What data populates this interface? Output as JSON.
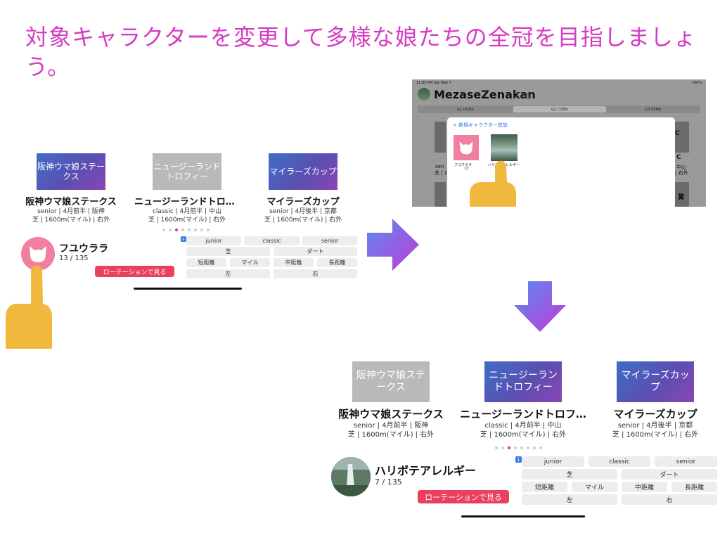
{
  "headline": "対象キャラクターを変更して多様な娘たちの全冠を目指しましょう。",
  "panel1": {
    "cards": [
      {
        "thumb": "阪神ウマ娘ステークス",
        "name": "阪神ウマ娘ステークス",
        "meta1": "senior | 4月前半 | 阪神",
        "meta2": "芝 | 1600m(マイル) | 右外"
      },
      {
        "thumb": "ニュージーランドトロフィー",
        "name": "ニュージーランドトロフ…",
        "meta1": "classic | 4月前半 | 中山",
        "meta2": "芝 | 1600m(マイル) | 右外"
      },
      {
        "thumb": "マイラーズカップ",
        "name": "マイラーズカップ",
        "meta1": "senior | 4月後半 | 京都",
        "meta2": "芝 | 1600m(マイル) | 右外"
      }
    ],
    "character": {
      "name": "フユウララ",
      "count": "13 / 135"
    },
    "rotation_button": "ローテーションで見る"
  },
  "panel3": {
    "cards": [
      {
        "thumb": "阪神ウマ娘ステークス",
        "name": "阪神ウマ娘ステークス",
        "meta1": "senior | 4月前半 | 阪神",
        "meta2": "芝 | 1600m(マイル) | 右外"
      },
      {
        "thumb": "ニュージーランドトロフィー",
        "name": "ニュージーランドトロフ…",
        "meta1": "classic | 4月前半 | 中山",
        "meta2": "芝 | 1600m(マイル) | 右外"
      },
      {
        "thumb": "マイラーズカップ",
        "name": "マイラーズカップ",
        "meta1": "senior | 4月後半 | 京都",
        "meta2": "芝 | 1600m(マイル) | 右外"
      }
    ],
    "character": {
      "name": "ハリボテアレルギー",
      "count": "7 / 135"
    },
    "rotation_button": "ローテーションで見る"
  },
  "filters": {
    "grade": [
      "junior",
      "classic",
      "senior"
    ],
    "surface": [
      "芝",
      "ダート"
    ],
    "distance": [
      "短距離",
      "マイル",
      "中距離",
      "長距離"
    ],
    "direction": [
      "左",
      "右"
    ]
  },
  "tablet": {
    "status_left": "11:03 PM  Sat May 7",
    "status_right": "100%",
    "app_title": "MezaseZenakan",
    "help": "?",
    "segments": [
      "G1 (6/30)",
      "G2 (7/36)",
      "G3 (0/69)"
    ],
    "add_character": "+ 新規キャラクター追加",
    "characters": [
      {
        "name": "フユウララ",
        "count": "13"
      },
      {
        "name": "ハリボテアレルギー",
        "count": ""
      }
    ],
    "bg_fragments": {
      "c_left": "C",
      "c_right": "C",
      "sen": "sen",
      "shi": "芝 | 24",
      "nakayama": "中山",
      "migisoto": "| 右外",
      "sho": "賞"
    }
  },
  "colors": {
    "accent": "#ea3f5f",
    "headline": "#d63bc4",
    "card_gradient_start": "#3f6dc8",
    "card_gradient_end": "#8a45b8",
    "finger": "#f0b83c"
  }
}
